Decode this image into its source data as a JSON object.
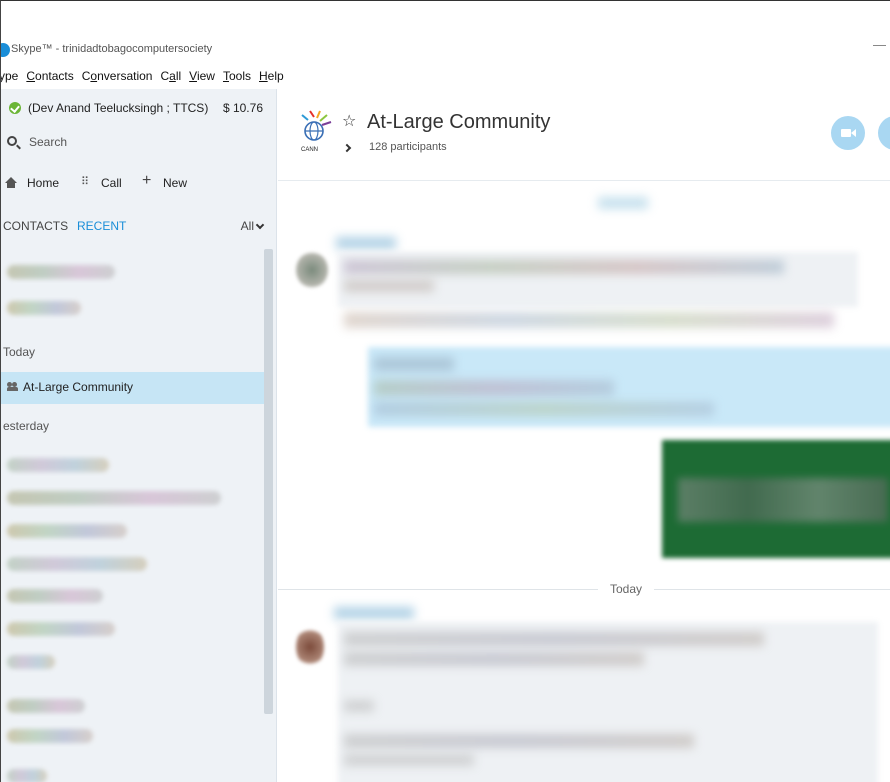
{
  "window": {
    "title": "Skype™ - trinidadtobagocomputersociety",
    "minimize_glyph": "—"
  },
  "menubar": {
    "items": [
      {
        "label": "ype",
        "underline": ""
      },
      {
        "label": "Contacts",
        "underline": "C"
      },
      {
        "label": "Conversation",
        "underline": "o"
      },
      {
        "label": "Call",
        "underline": "a"
      },
      {
        "label": "View",
        "underline": "V"
      },
      {
        "label": "Tools",
        "underline": "T"
      },
      {
        "label": "Help",
        "underline": "H"
      }
    ]
  },
  "sidebar": {
    "profile_name": "(Dev Anand Teelucksingh ; TTCS)",
    "credit": "$ 10.76",
    "search_label": "Search",
    "actions": {
      "home": "Home",
      "call": "Call",
      "new": "New"
    },
    "tabs": {
      "contacts": "CONTACTS",
      "recent": "RECENT",
      "filter": "All"
    },
    "groups": {
      "today": "Today",
      "yesterday": "esterday"
    },
    "selected_item": "At-Large Community"
  },
  "conversation": {
    "title": "At-Large Community",
    "participants": "128 participants",
    "divider": "Today"
  },
  "colors": {
    "accent": "#1a8ed8",
    "selected_row": "#c6e5f5",
    "sidebar_bg": "#eef2f6",
    "status_online": "#6bb536",
    "header_button": "#a9d7f2",
    "image_green": "#1d6b34"
  }
}
